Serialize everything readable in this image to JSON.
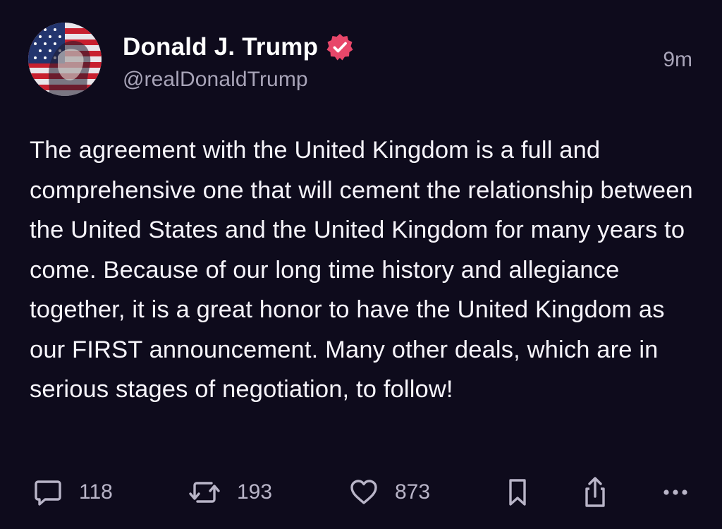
{
  "author": {
    "display_name": "Donald J. Trump",
    "handle": "@realDonaldTrump",
    "verified": true,
    "avatar": "flag-portrait-avatar"
  },
  "timestamp": "9m",
  "post": {
    "text": "The agreement with the United Kingdom is a full and comprehensive one that will cement the relationship between the United States and the United Kingdom for many years to come. Because of our long time history and allegiance together, it is a great honor to have the United Kingdom as our FIRST announcement. Many other deals, which are in serious stages of negotiation, to follow!"
  },
  "actions": {
    "reply": {
      "icon": "comment-icon",
      "count": "118"
    },
    "retruth": {
      "icon": "repost-icon",
      "count": "193"
    },
    "like": {
      "icon": "heart-icon",
      "count": "873"
    },
    "bookmark": {
      "icon": "bookmark-icon"
    },
    "share": {
      "icon": "share-icon"
    },
    "more": {
      "icon": "more-icon"
    }
  },
  "colors": {
    "background": "#0e0b1c",
    "text": "#f6f4fa",
    "muted": "#a8a4b8",
    "verified_badge": "#e8476a"
  }
}
